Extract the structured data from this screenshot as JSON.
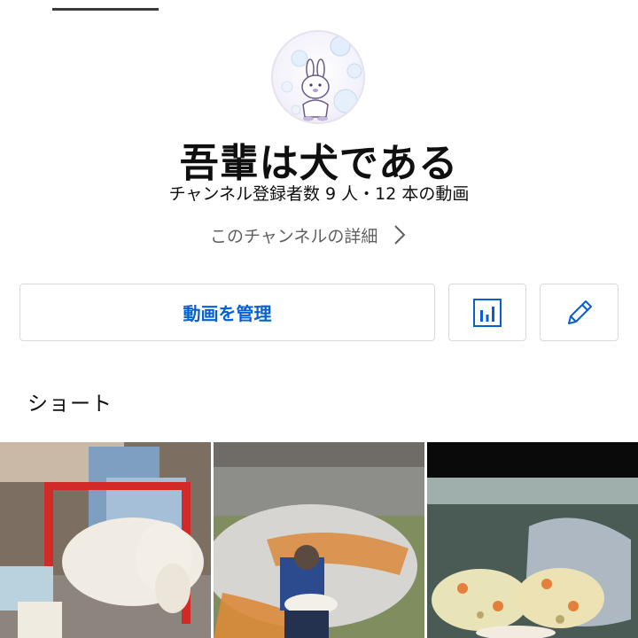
{
  "channel": {
    "name": "吾輩は犬である",
    "stats": "チャンネル登録者数 9 人・12 本の動画",
    "details_link": "このチャンネルの詳細"
  },
  "actions": {
    "manage_videos_label": "動画を管理",
    "analytics_icon": "analytics-bar-chart-icon",
    "edit_icon": "pencil-edit-icon"
  },
  "shorts": {
    "section_title": "ショート",
    "items": [
      {
        "thumbnail": "dog-in-red-wheelchair"
      },
      {
        "thumbnail": "man-holding-dog-on-riverbank"
      },
      {
        "thumbnail": "food-in-plastic-bag"
      }
    ]
  },
  "colors": {
    "accent": "#065fd4",
    "text_primary": "#0f0f0f",
    "text_secondary": "#606060",
    "border": "#d9d9d9"
  }
}
